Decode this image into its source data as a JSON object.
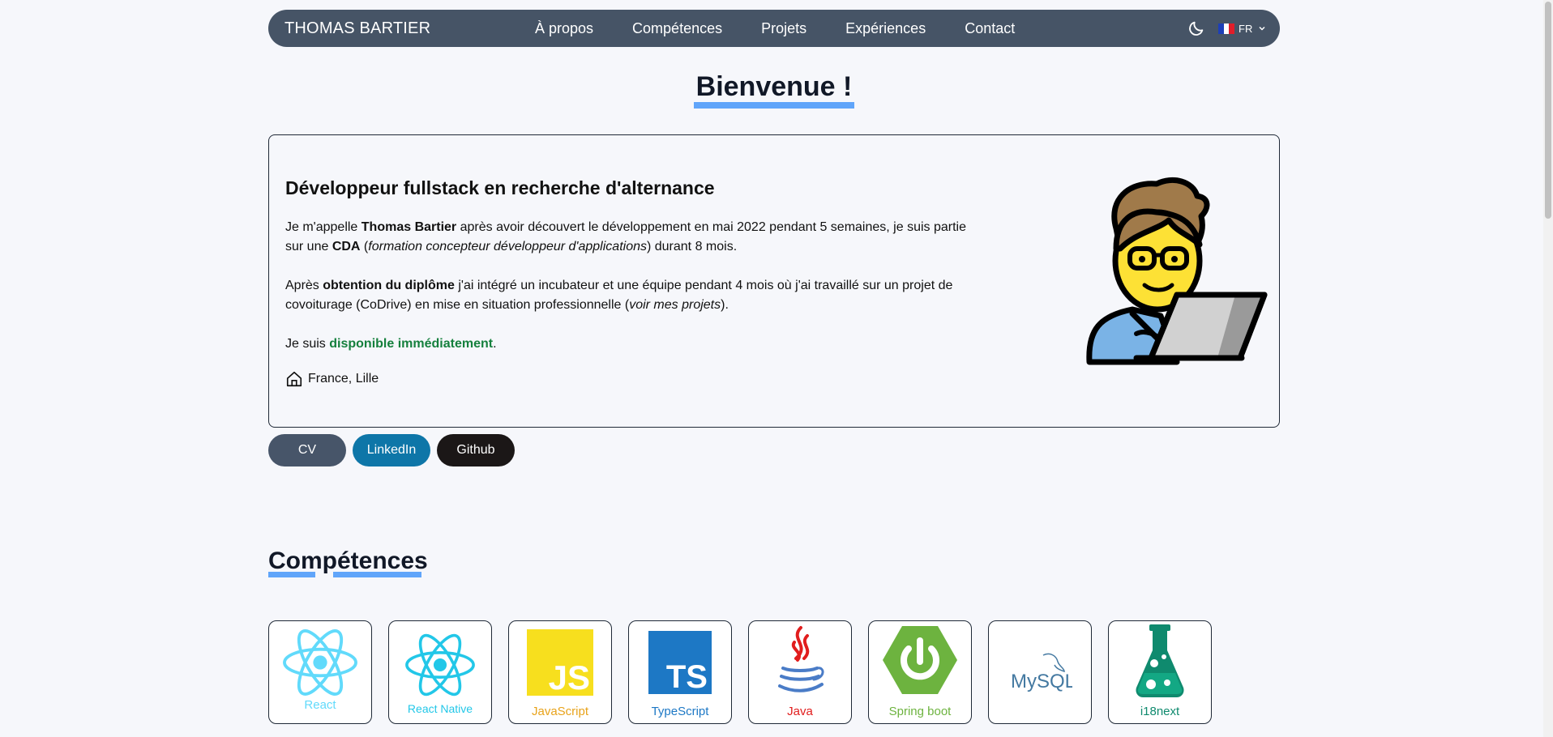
{
  "nav": {
    "brand": "THOMAS BARTIER",
    "links": [
      "À propos",
      "Compétences",
      "Projets",
      "Expériences",
      "Contact"
    ],
    "lang": "FR"
  },
  "hero": {
    "welcome": "Bienvenue !",
    "title": "Développeur fullstack en recherche d'alternance",
    "p1": {
      "a": "Je m'appelle ",
      "name": "Thomas Bartier",
      "b": " après avoir découvert le développement en mai 2022 pendant 5 semaines, je suis partie sur une ",
      "cda": "CDA",
      "c": " (",
      "cda_full": "formation concepteur développeur d'applications",
      "d": ") durant 8 mois."
    },
    "p2": {
      "a": "Après ",
      "diploma": "obtention du diplôme",
      "b": " j'ai intégré un incubateur et une équipe pendant 4 mois où j'ai travaillé sur un projet de covoiturage (CoDrive) en mise en situation professionnelle (",
      "projects": "voir mes projets",
      "c": ")."
    },
    "p3": {
      "a": "Je suis ",
      "available": "disponible immédiatement",
      "b": "."
    },
    "location": "France, Lille"
  },
  "buttons": {
    "cv": "CV",
    "linkedin": "LinkedIn",
    "github": "Github"
  },
  "skills": {
    "title": "Compétences",
    "items": [
      {
        "label": "React",
        "color": "#61dafb"
      },
      {
        "label": "React Native",
        "color": "#22c7e8"
      },
      {
        "label": "JavaScript",
        "color": "#e8a31b"
      },
      {
        "label": "TypeScript",
        "color": "#1d78c5"
      },
      {
        "label": "Java",
        "color": "#e11d1d"
      },
      {
        "label": "Spring boot",
        "color": "#6db33f"
      },
      {
        "label": "",
        "logo_text": "MySQL",
        "color": "#4479a1"
      },
      {
        "label": "i18next",
        "color": "#0f8a6e"
      }
    ]
  },
  "colors": {
    "navbar": "#465466",
    "accent_underline": "#60a5fa",
    "available_green": "#15803d",
    "linkedin": "#0e76a8",
    "github": "#1b1717",
    "cv": "#475569"
  }
}
